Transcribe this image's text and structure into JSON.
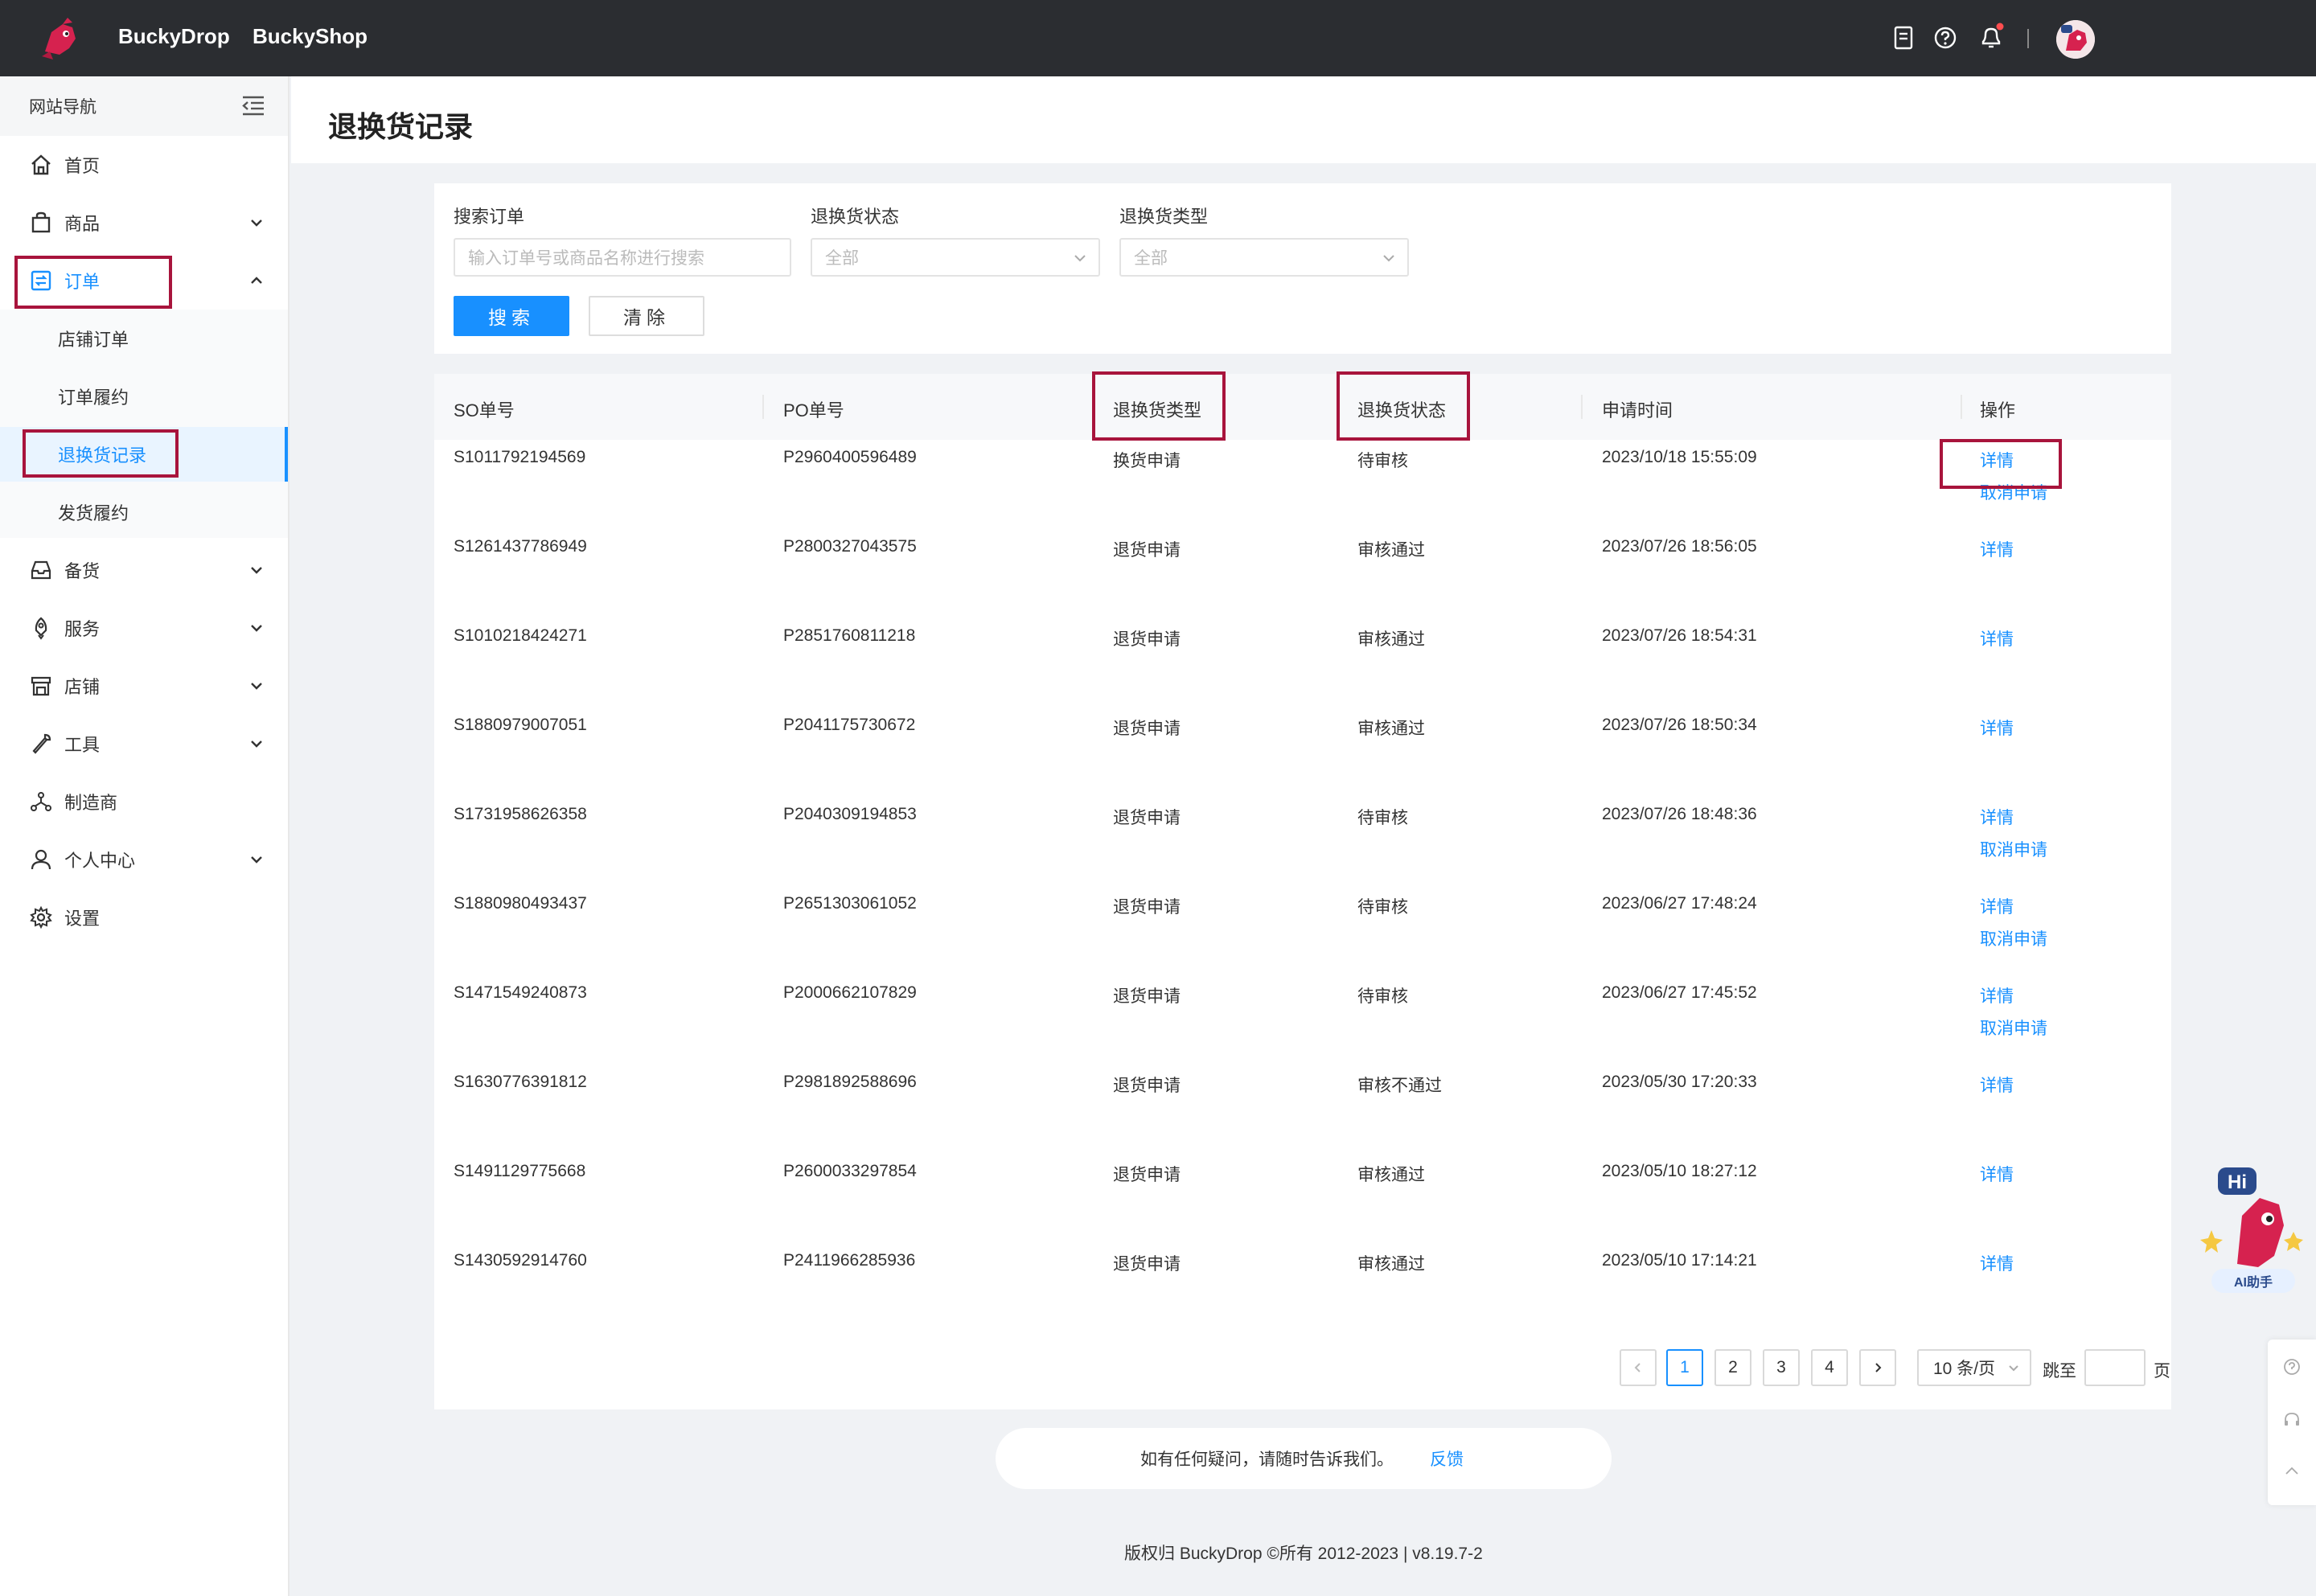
{
  "header": {
    "nav": [
      "BuckyDrop",
      "BuckyShop"
    ]
  },
  "sidebar": {
    "title": "网站导航",
    "items": [
      {
        "label": "首页"
      },
      {
        "label": "商品"
      },
      {
        "label": "订单"
      },
      {
        "label": "备货"
      },
      {
        "label": "服务"
      },
      {
        "label": "店铺"
      },
      {
        "label": "工具"
      },
      {
        "label": "制造商"
      },
      {
        "label": "个人中心"
      },
      {
        "label": "设置"
      }
    ],
    "subitems": [
      {
        "label": "店铺订单"
      },
      {
        "label": "订单履约"
      },
      {
        "label": "退换货记录"
      },
      {
        "label": "发货履约"
      }
    ]
  },
  "page": {
    "title": "退换货记录"
  },
  "filters": {
    "search_label": "搜索订单",
    "search_placeholder": "输入订单号或商品名称进行搜索",
    "status_label": "退换货状态",
    "status_value": "全部",
    "type_label": "退换货类型",
    "type_value": "全部",
    "search_button": "搜索",
    "clear_button": "清除"
  },
  "table": {
    "columns": [
      "SO单号",
      "PO单号",
      "退换货类型",
      "退换货状态",
      "申请时间",
      "操作"
    ],
    "rows": [
      {
        "so": "S1011792194569",
        "po": "P2960400596489",
        "type": "换货申请",
        "status": "待审核",
        "time": "2023/10/18 15:55:09",
        "detail": "详情",
        "cancel": "取消申请"
      },
      {
        "so": "S1261437786949",
        "po": "P2800327043575",
        "type": "退货申请",
        "status": "审核通过",
        "time": "2023/07/26 18:56:05",
        "detail": "详情",
        "cancel": ""
      },
      {
        "so": "S1010218424271",
        "po": "P2851760811218",
        "type": "退货申请",
        "status": "审核通过",
        "time": "2023/07/26 18:54:31",
        "detail": "详情",
        "cancel": ""
      },
      {
        "so": "S1880979007051",
        "po": "P2041175730672",
        "type": "退货申请",
        "status": "审核通过",
        "time": "2023/07/26 18:50:34",
        "detail": "详情",
        "cancel": ""
      },
      {
        "so": "S1731958626358",
        "po": "P2040309194853",
        "type": "退货申请",
        "status": "待审核",
        "time": "2023/07/26 18:48:36",
        "detail": "详情",
        "cancel": "取消申请"
      },
      {
        "so": "S1880980493437",
        "po": "P2651303061052",
        "type": "退货申请",
        "status": "待审核",
        "time": "2023/06/27 17:48:24",
        "detail": "详情",
        "cancel": "取消申请"
      },
      {
        "so": "S1471549240873",
        "po": "P2000662107829",
        "type": "退货申请",
        "status": "待审核",
        "time": "2023/06/27 17:45:52",
        "detail": "详情",
        "cancel": "取消申请"
      },
      {
        "so": "S1630776391812",
        "po": "P2981892588696",
        "type": "退货申请",
        "status": "审核不通过",
        "time": "2023/05/30 17:20:33",
        "detail": "详情",
        "cancel": ""
      },
      {
        "so": "S1491129775668",
        "po": "P2600033297854",
        "type": "退货申请",
        "status": "审核通过",
        "time": "2023/05/10 18:27:12",
        "detail": "详情",
        "cancel": ""
      },
      {
        "so": "S1430592914760",
        "po": "P2411966285936",
        "type": "退货申请",
        "status": "审核通过",
        "time": "2023/05/10 17:14:21",
        "detail": "详情",
        "cancel": ""
      }
    ]
  },
  "pagination": {
    "pages": [
      "1",
      "2",
      "3",
      "4"
    ],
    "current": "1",
    "page_size": "10 条/页",
    "jump_label": "跳至",
    "page_suffix": "页"
  },
  "feedback": {
    "text": "如有任何疑问，请随时告诉我们。",
    "link": "反馈"
  },
  "footer": {
    "copyright": "版权归 BuckyDrop ©所有 2012-2023 | v8.19.7-2"
  },
  "ai_widget": {
    "badge": "Hi",
    "label": "AI助手"
  },
  "colors": {
    "accent": "#1890ff",
    "topbar": "#2b2d31",
    "highlight": "#a8143c"
  }
}
